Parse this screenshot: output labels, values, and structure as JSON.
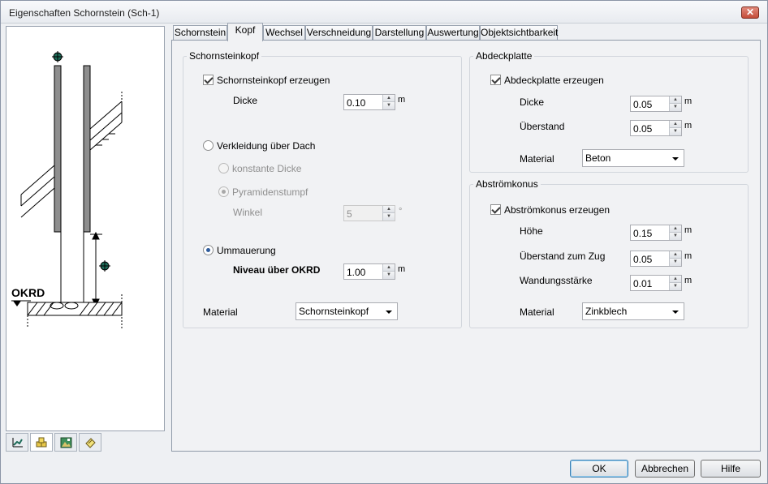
{
  "window": {
    "title": "Eigenschaften Schornstein (Sch-1)",
    "close_glyph": "✕"
  },
  "preview": {
    "okrd_label": "OKRD"
  },
  "view_buttons": [
    "chart-icon",
    "cubes-icon",
    "landscape-icon",
    "sheet-icon"
  ],
  "tabs": [
    "Schornstein",
    "Kopf",
    "Wechsel",
    "Verschneidung",
    "Darstellung",
    "Auswertung",
    "Objektsichtbarkeit"
  ],
  "active_tab": "Kopf",
  "schornsteinkopf": {
    "title": "Schornsteinkopf",
    "create_label": "Schornsteinkopf erzeugen",
    "dicke_label": "Dicke",
    "dicke_value": "0.10",
    "dicke_unit": "m",
    "verkleidung_label": "Verkleidung über Dach",
    "konstante_label": "konstante Dicke",
    "pyramide_label": "Pyramidenstumpf",
    "winkel_label": "Winkel",
    "winkel_value": "5",
    "winkel_unit": "°",
    "ummauerung_label": "Ummauerung",
    "niveau_label": "Niveau über OKRD",
    "niveau_value": "1.00",
    "niveau_unit": "m",
    "material_label": "Material",
    "material_value": "Schornsteinkopf"
  },
  "abdeckplatte": {
    "title": "Abdeckplatte",
    "create_label": "Abdeckplatte erzeugen",
    "dicke_label": "Dicke",
    "dicke_value": "0.05",
    "dicke_unit": "m",
    "ueberstand_label": "Überstand",
    "ueberstand_value": "0.05",
    "ueberstand_unit": "m",
    "material_label": "Material",
    "material_value": "Beton"
  },
  "abstroemkonus": {
    "title": "Abströmkonus",
    "create_label": "Abströmkonus erzeugen",
    "hoehe_label": "Höhe",
    "hoehe_value": "0.15",
    "hoehe_unit": "m",
    "ueberstand_label": "Überstand zum Zug",
    "ueberstand_value": "0.05",
    "ueberstand_unit": "m",
    "wandung_label": "Wandungsstärke",
    "wandung_value": "0.01",
    "wandung_unit": "m",
    "material_label": "Material",
    "material_value": "Zinkblech"
  },
  "buttons": {
    "ok": "OK",
    "cancel": "Abbrechen",
    "help": "Hilfe"
  }
}
